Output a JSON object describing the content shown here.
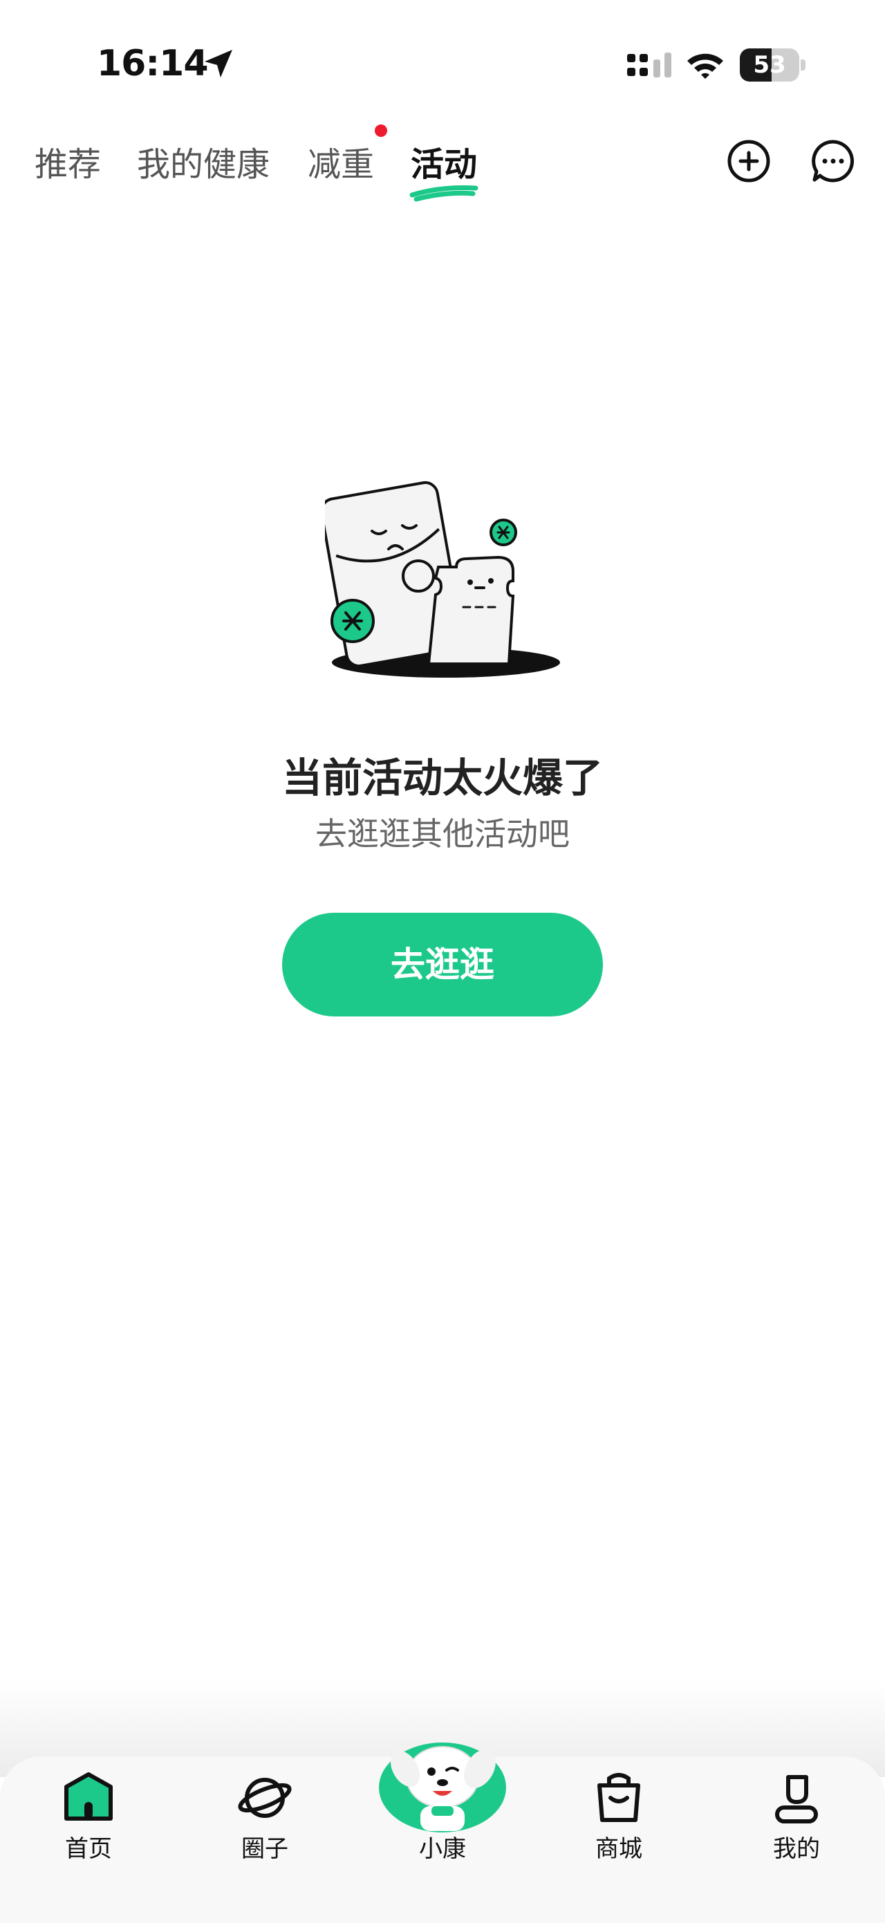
{
  "status_bar": {
    "time": "16:14",
    "battery": "53",
    "battery_level": 0.53,
    "icons": [
      "location-arrow-icon",
      "signal-icon",
      "wifi-icon",
      "battery-icon"
    ]
  },
  "top_nav": {
    "tabs": [
      {
        "label": "推荐",
        "active": false,
        "badge": false
      },
      {
        "label": "我的健康",
        "active": false,
        "badge": false
      },
      {
        "label": "减重",
        "active": false,
        "badge": true
      },
      {
        "label": "活动",
        "active": true,
        "badge": false
      }
    ],
    "actions": [
      "plus-circle-icon",
      "message-icon"
    ],
    "accent_color": "#1dc98a",
    "badge_color": "#ee1b2e"
  },
  "empty_state": {
    "illustration": "sad-red-envelope-illustration",
    "title": "当前活动太火爆了",
    "subtitle": "去逛逛其他活动吧",
    "button_label": "去逛逛",
    "button_color": "#1dc98a"
  },
  "bottom_nav": {
    "items": [
      {
        "label": "首页",
        "icon": "home-icon",
        "active": true
      },
      {
        "label": "圈子",
        "icon": "planet-icon",
        "active": false
      },
      {
        "label": "小康",
        "icon": "mascot-icon",
        "active": false
      },
      {
        "label": "商城",
        "icon": "shopping-bag-icon",
        "active": false
      },
      {
        "label": "我的",
        "icon": "profile-icon",
        "active": false
      }
    ]
  }
}
